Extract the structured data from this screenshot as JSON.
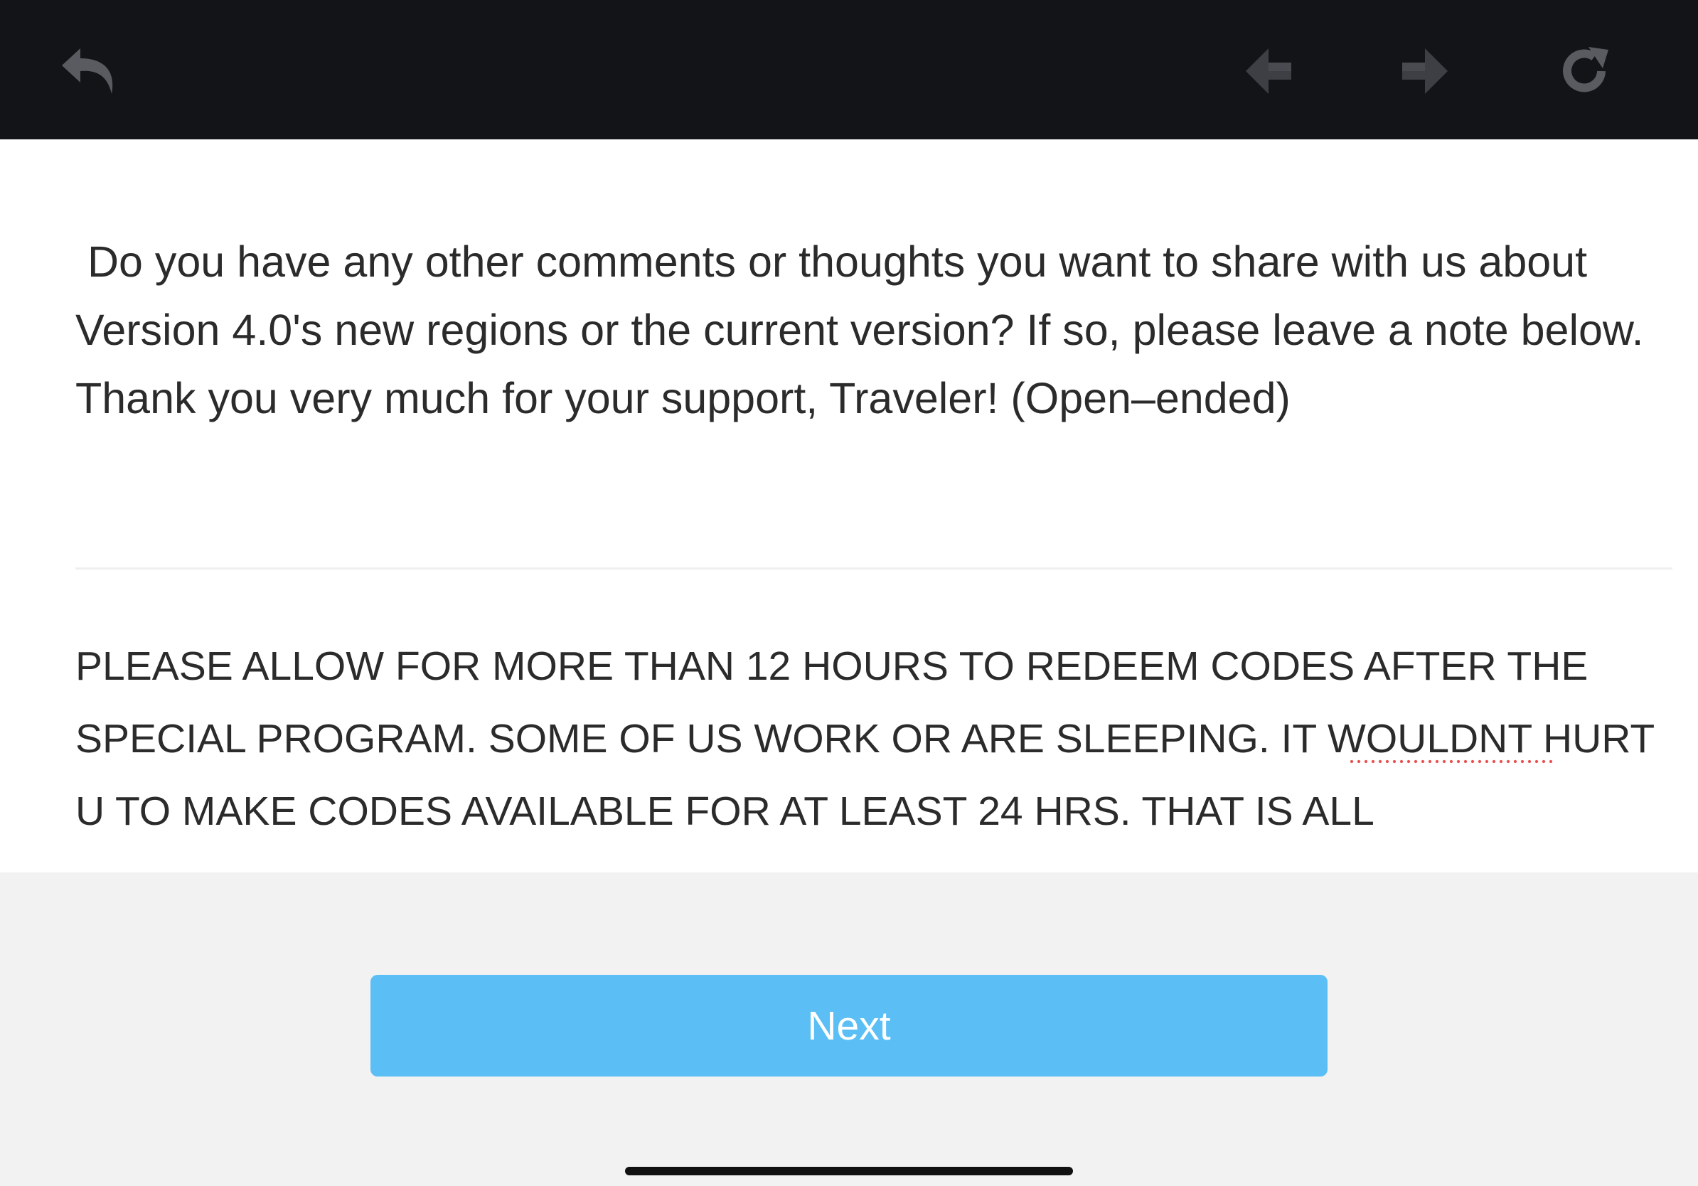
{
  "toolbar": {
    "back_icon": "undo-arrow-icon",
    "prev_icon": "previous-arrow-icon",
    "next_icon": "next-arrow-icon",
    "refresh_icon": "refresh-icon",
    "background_color": "#131418",
    "icon_color": "#5a5b60"
  },
  "survey": {
    "question": " Do you have any other comments or thoughts you want to share with us about Version 4.0's new regions or the current version? If so, please leave a note below. Thank you very much for your support, Traveler! (Open–ended)",
    "answer": "PLEASE ALLOW FOR MORE THAN 12 HOURS TO REDEEM CODES AFTER THE SPECIAL PROGRAM. SOME OF US WORK OR ARE SLEEPING. IT WOULDNT HURT U TO MAKE CODES AVAILABLE FOR AT LEAST 24 HRS. THAT IS ALL"
  },
  "footer": {
    "next_label": "Next",
    "button_color": "#5bbff6"
  }
}
